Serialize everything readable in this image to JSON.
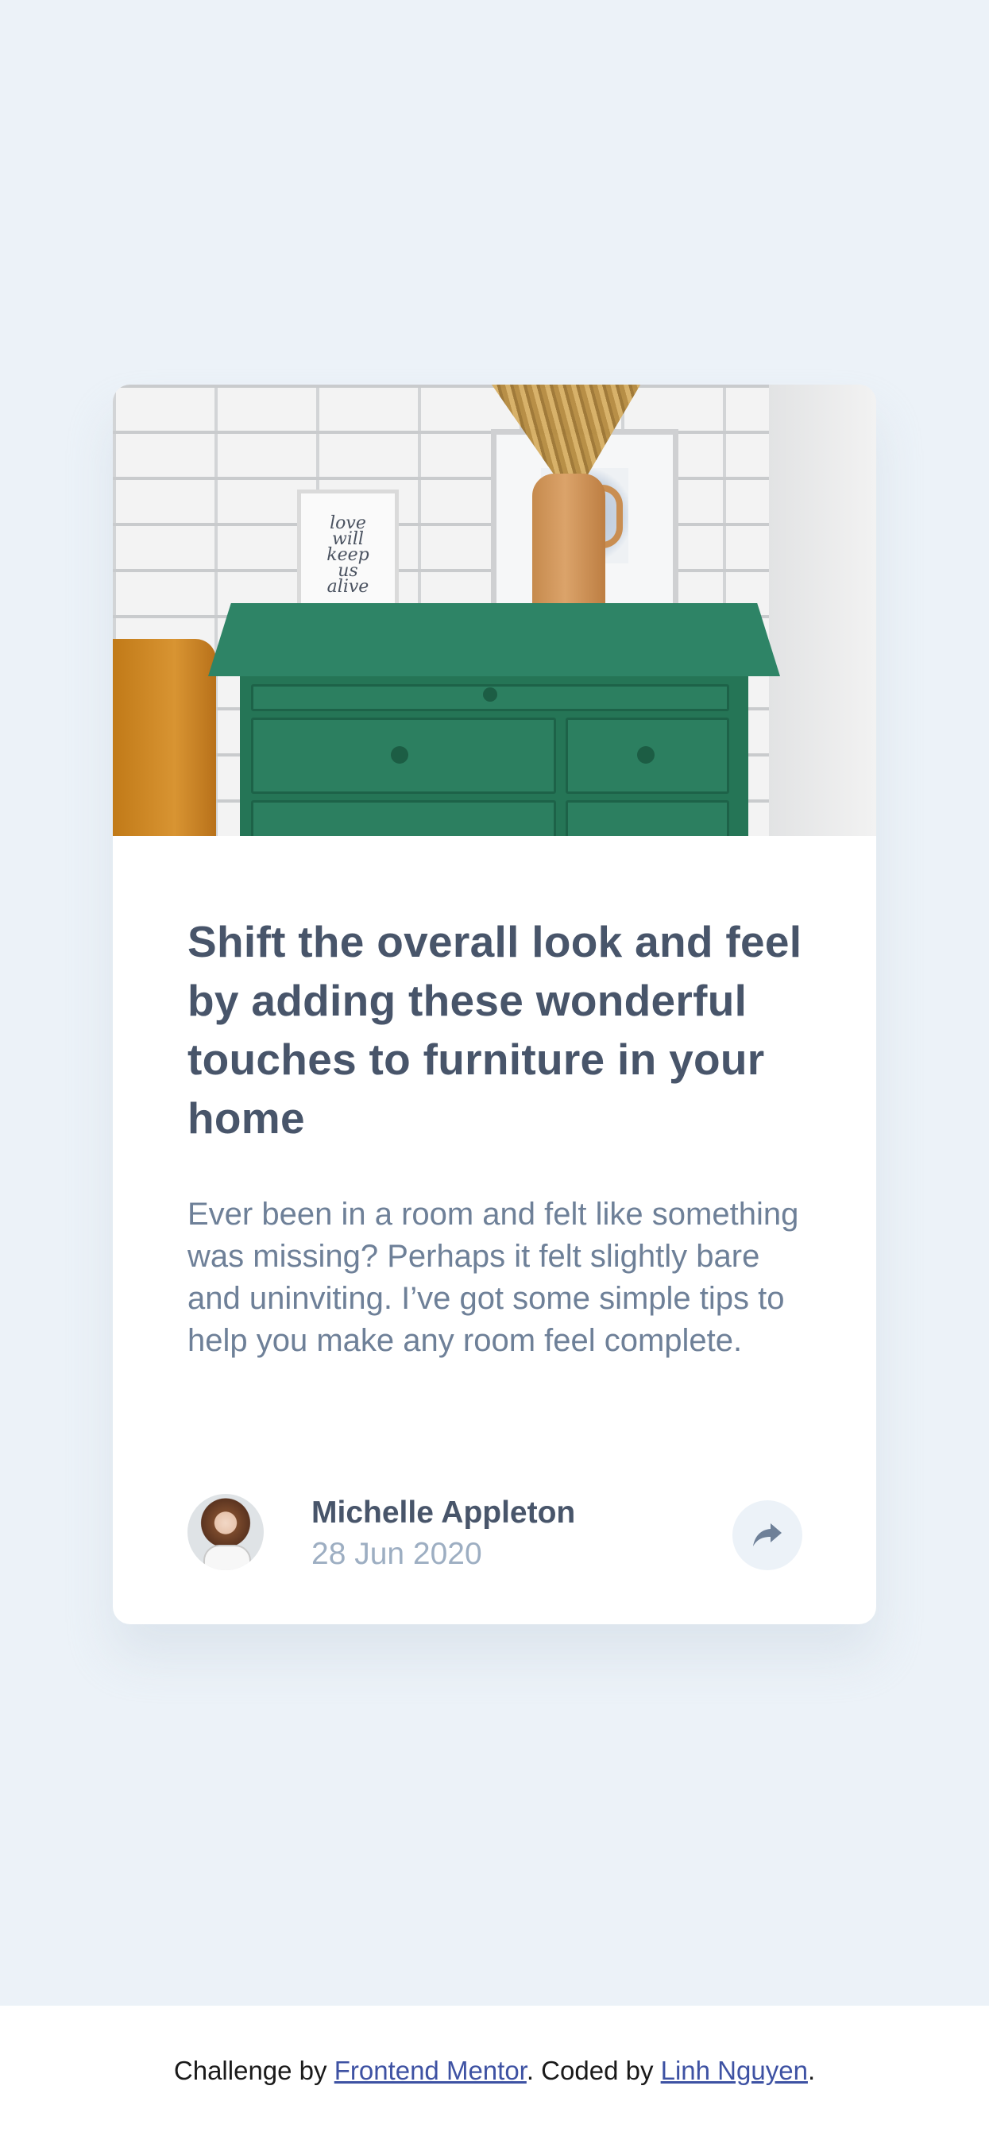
{
  "card": {
    "image": {
      "frame_text": "love will keep us alive"
    },
    "title": "Shift the overall look and feel by adding these wonderful touches to furniture in your home",
    "description": "Ever been in a room and felt like something was missing? Perhaps it felt slightly bare and uninviting. I’ve got some simple tips to help you make any room feel complete.",
    "author": {
      "name": "Michelle Appleton",
      "date": "28 Jun 2020"
    },
    "share_icon": "share-arrow-icon"
  },
  "footer": {
    "prefix": "Challenge by ",
    "challenge_link": "Frontend Mentor",
    "middle": ". Coded by ",
    "author_link": "Linh Nguyen",
    "suffix": "."
  },
  "colors": {
    "page_background": "#ecf2f8",
    "title": "#48556a",
    "body_text": "#6e8098",
    "date": "#9daec2",
    "link": "#3e52a3"
  }
}
